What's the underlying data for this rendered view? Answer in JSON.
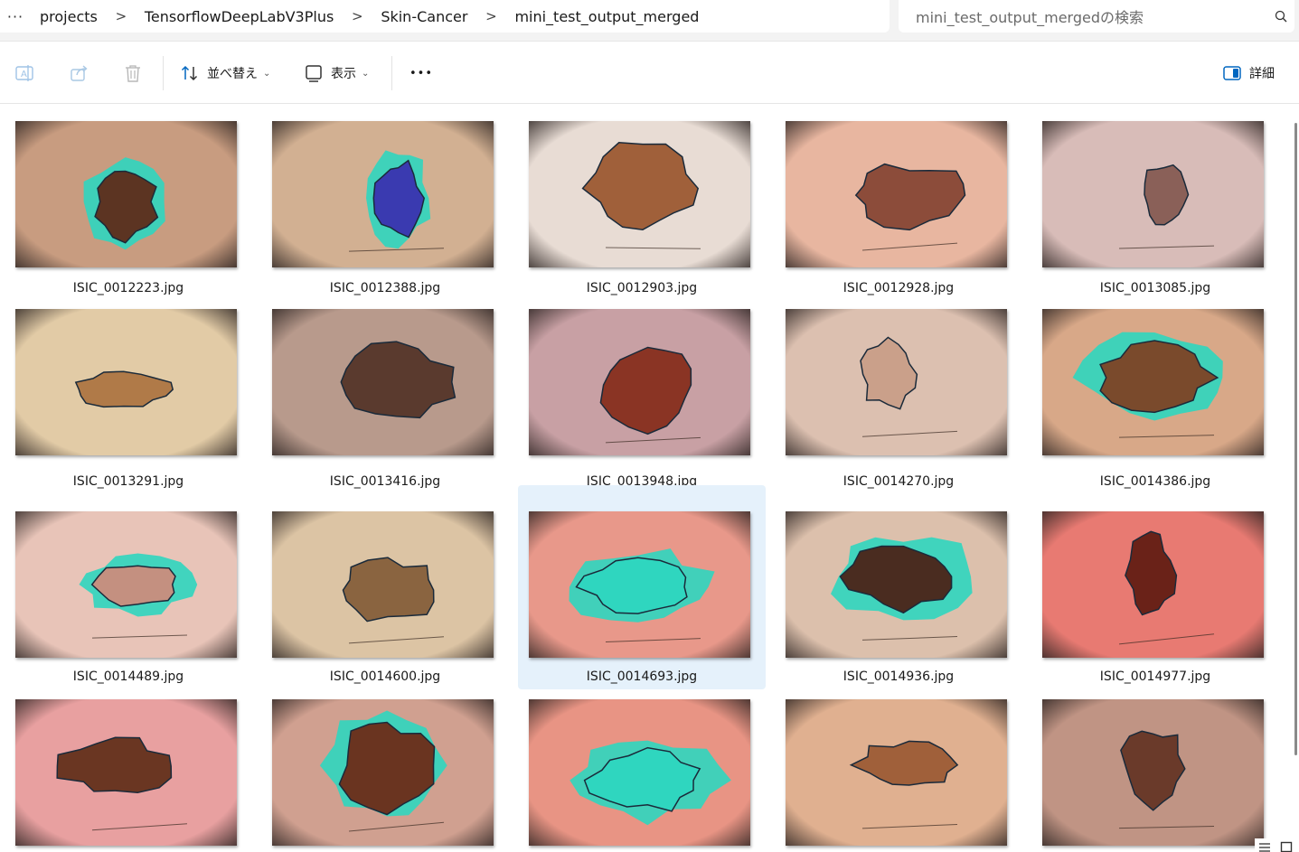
{
  "breadcrumb": {
    "overflow_label": "···",
    "separator": ">",
    "items": [
      "projects",
      "TensorflowDeepLabV3Plus",
      "Skin-Cancer",
      "mini_test_output_merged"
    ]
  },
  "search": {
    "placeholder": "mini_test_output_mergedの検索"
  },
  "toolbar": {
    "sort_label": "並べ替え",
    "view_label": "表示",
    "more_label": "•••",
    "details_label": "詳細"
  },
  "colors": {
    "accent": "#0067c0",
    "selection": "#e5f1fb",
    "mask_teal": "#2fd6bf",
    "mask_blue": "#3a1fd1"
  },
  "files": [
    {
      "name": "ISIC_0012223.jpg",
      "bg": "#c89c80",
      "lesion": "#5c3422",
      "mask": true,
      "selected": false
    },
    {
      "name": "ISIC_0012388.jpg",
      "bg": "#d2b092",
      "lesion": "#3a3ab0",
      "mask": true,
      "selected": false
    },
    {
      "name": "ISIC_0012903.jpg",
      "bg": "#e8dcd4",
      "lesion": "#a0603a",
      "mask": false,
      "selected": false
    },
    {
      "name": "ISIC_0012928.jpg",
      "bg": "#e8b6a0",
      "lesion": "#8c4c3a",
      "mask": false,
      "selected": false
    },
    {
      "name": "ISIC_0013085.jpg",
      "bg": "#d8bcb8",
      "lesion": "#8a6058",
      "mask": false,
      "selected": false
    },
    {
      "name": "ISIC_0013291.jpg",
      "bg": "#e2cba6",
      "lesion": "#b07a48",
      "mask": false,
      "selected": false
    },
    {
      "name": "ISIC_0013416.jpg",
      "bg": "#b89a8c",
      "lesion": "#5a3a2e",
      "mask": false,
      "selected": false
    },
    {
      "name": "ISIC_0013948.jpg",
      "bg": "#c8a0a4",
      "lesion": "#8a3424",
      "mask": false,
      "selected": false
    },
    {
      "name": "ISIC_0014270.jpg",
      "bg": "#dcc0b0",
      "lesion": "#caa08a",
      "mask": false,
      "selected": false
    },
    {
      "name": "ISIC_0014386.jpg",
      "bg": "#d8a888",
      "lesion": "#7a4a2c",
      "mask": true,
      "selected": false
    },
    {
      "name": "ISIC_0014489.jpg",
      "bg": "#e8c4b8",
      "lesion": "#c49080",
      "mask": true,
      "selected": false
    },
    {
      "name": "ISIC_0014600.jpg",
      "bg": "#dcc4a4",
      "lesion": "#8a6440",
      "mask": false,
      "selected": false
    },
    {
      "name": "ISIC_0014693.jpg",
      "bg": "#e8988a",
      "lesion": "#2fd6bf",
      "mask": true,
      "selected": true
    },
    {
      "name": "ISIC_0014936.jpg",
      "bg": "#dcc0ac",
      "lesion": "#4a2c20",
      "mask": true,
      "selected": false
    },
    {
      "name": "ISIC_0014977.jpg",
      "bg": "#e87a72",
      "lesion": "#6a2218",
      "mask": false,
      "selected": false
    },
    {
      "name": "",
      "bg": "#e8a0a0",
      "lesion": "#6a3622",
      "mask": false,
      "selected": false
    },
    {
      "name": "",
      "bg": "#d0a090",
      "lesion": "#6a3420",
      "mask": true,
      "selected": false
    },
    {
      "name": "",
      "bg": "#e89484",
      "lesion": "#2fd6bf",
      "mask": true,
      "selected": false
    },
    {
      "name": "",
      "bg": "#e0b090",
      "lesion": "#a0603a",
      "mask": false,
      "selected": false
    },
    {
      "name": "",
      "bg": "#c09484",
      "lesion": "#6a3a2a",
      "mask": false,
      "selected": false
    }
  ]
}
